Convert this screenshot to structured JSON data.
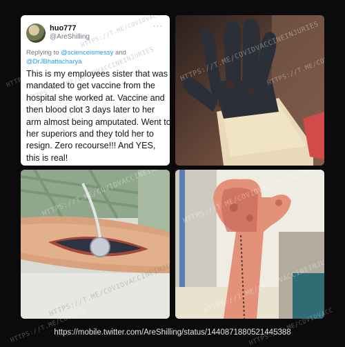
{
  "tweet": {
    "display_name": "huo777",
    "handle": "@AreShilling",
    "more_icon": "more-icon",
    "reply_prefix": "Replying to",
    "reply_to": [
      "@scienceismessy",
      "and",
      "@DrJBhattacharya"
    ],
    "text": "This is my employees sister that was mandated to get vaccine from the hospital she worked at. Vaccine and then blood clot 3 days later to her arm almost being amputated. Went to her superiors and they told her to resign. Zero recourse!!! And YES, this is real!"
  },
  "watermark": "HTTPS://T.ME/COVIDVACCINEINJURIES",
  "footer_url": "https://mobile.twitter.com/AreShilling/status/1440871880521445388"
}
